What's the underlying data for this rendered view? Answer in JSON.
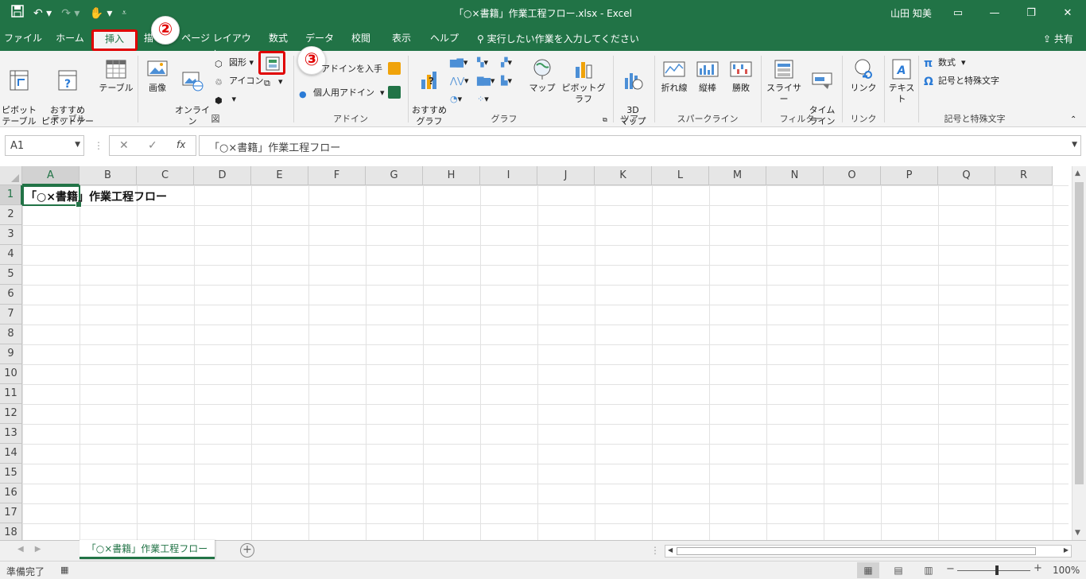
{
  "app": {
    "window_title": "「○×書籍」作業工程フロー.xlsx  -  Excel",
    "user": "山田 知美",
    "share": "共有",
    "accent": "#217346",
    "highlight": "#e00000"
  },
  "qat": {
    "save_icon": "save-icon",
    "undo_icon": "undo-icon",
    "redo_icon": "redo-icon",
    "touch_icon": "touch-mode-icon"
  },
  "tabs": [
    {
      "label": "ファイル"
    },
    {
      "label": "ホーム"
    },
    {
      "label": "挿入"
    },
    {
      "label": "描"
    },
    {
      "label": "ページ レイアウト"
    },
    {
      "label": "数式"
    },
    {
      "label": "データ"
    },
    {
      "label": "校閲"
    },
    {
      "label": "表示"
    },
    {
      "label": "ヘルプ"
    }
  ],
  "tellme": "実行したい作業を入力してください",
  "callouts": {
    "step2": "②",
    "step3": "③"
  },
  "ribbon": {
    "table_group": {
      "label": "テーブル",
      "pivot": "ピボット\nテーブル",
      "recommended_pivot": "おすすめ\nピボットテーブル",
      "table": "テーブル"
    },
    "illust_group": {
      "label": "図",
      "picture": "画像",
      "online_picture": "オンライン\n画像",
      "shapes": "図形",
      "icons": "アイコン"
    },
    "addin_group": {
      "label": "アドイン",
      "get_addins": "アドインを入手",
      "my_addins": "個人用アドイン"
    },
    "chart_group": {
      "label": "グラフ",
      "recommended_charts": "おすすめ\nグラフ",
      "maps": "マップ",
      "pivot_chart": "ピボットグラフ"
    },
    "tour_group": {
      "label": "ツアー",
      "map3d": "3D\nマップ"
    },
    "spark_group": {
      "label": "スパークライン",
      "line": "折れ線",
      "column": "縦棒",
      "winloss": "勝敗"
    },
    "filter_group": {
      "label": "フィルター",
      "slicer": "スライサー",
      "timeline": "タイム\nライン"
    },
    "link_group": {
      "label": "リンク",
      "link": "リンク"
    },
    "text_group": {
      "text": "テキスト"
    },
    "symbol_group": {
      "label": "記号と特殊文字",
      "equation": "数式",
      "symbol": "記号と特殊文字"
    }
  },
  "formula_bar": {
    "name_box": "A1",
    "fx": "fx",
    "content": "「○×書籍」作業工程フロー"
  },
  "grid": {
    "columns": [
      "A",
      "B",
      "C",
      "D",
      "E",
      "F",
      "G",
      "H",
      "I",
      "J",
      "K",
      "L",
      "M",
      "N",
      "O",
      "P",
      "Q",
      "R"
    ],
    "rows": [
      "1",
      "2",
      "3",
      "4",
      "5",
      "6",
      "7",
      "8",
      "9",
      "10",
      "11",
      "12",
      "13",
      "14",
      "15",
      "16",
      "17",
      "18"
    ],
    "a1_value": "「○×書籍」作業工程フロー"
  },
  "sheet_tab": "「○×書籍」作業工程フロー",
  "status": {
    "ready": "準備完了",
    "zoom": "100%",
    "zoom_percent": 100
  }
}
